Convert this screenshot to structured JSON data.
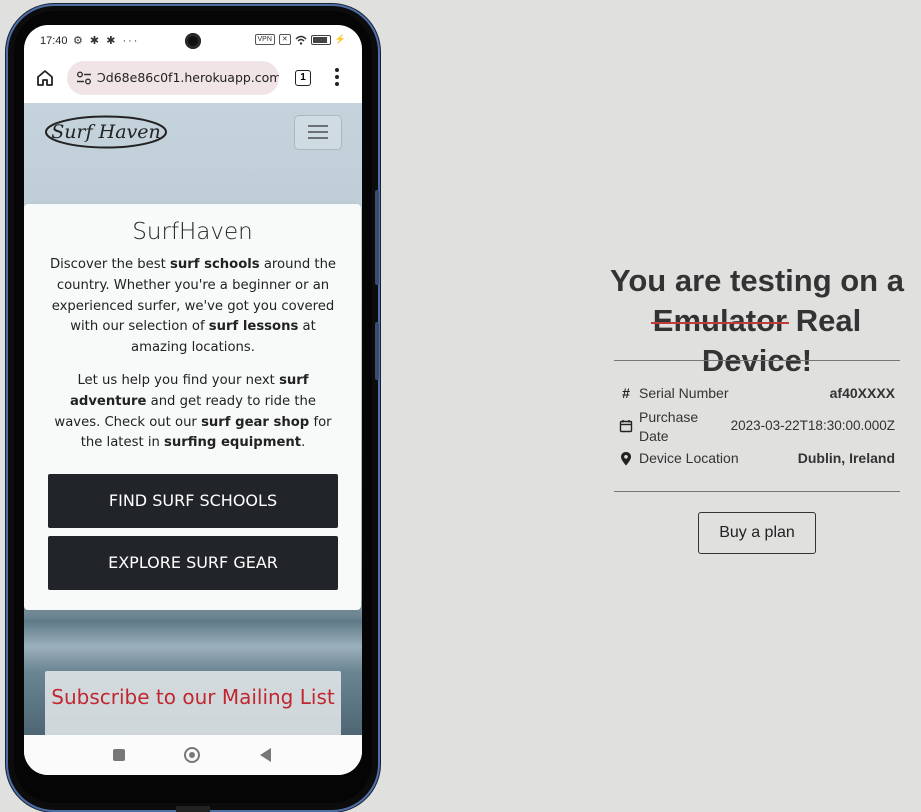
{
  "status_bar": {
    "time": "17:40",
    "left_icons": "⚙ ✱ ✱ ···",
    "vpn": "VPN",
    "signal": "✕"
  },
  "browser": {
    "url": "Ͻd68e86c0f1.herokuapp.com",
    "tab_count": "1"
  },
  "site": {
    "logo_text": "Surf Haven",
    "card_title": "SurfHaven",
    "para1": [
      {
        "t": "Discover the best ",
        "b": false
      },
      {
        "t": "surf schools",
        "b": true
      },
      {
        "t": " around the country. Whether you're a beginner or an experienced surfer, we've got you covered with our selection of ",
        "b": false
      },
      {
        "t": "surf lessons",
        "b": true
      },
      {
        "t": " at amazing locations.",
        "b": false
      }
    ],
    "para2": [
      {
        "t": "Let us help you find your next ",
        "b": false
      },
      {
        "t": "surf adventure",
        "b": true
      },
      {
        "t": " and get ready to ride the waves. Check out our ",
        "b": false
      },
      {
        "t": "surf gear shop",
        "b": true
      },
      {
        "t": " for the latest in ",
        "b": false
      },
      {
        "t": "surfing equipment",
        "b": true
      },
      {
        "t": ".",
        "b": false
      }
    ],
    "btn_find": "FIND SURF SCHOOLS",
    "btn_explore": "EXPLORE SURF GEAR",
    "subscribe": "Subscribe to our Mailing List"
  },
  "panel": {
    "headline_line1": "You are testing on a",
    "headline_strike": "Emulator",
    "headline_line2_rest": " Real Device!",
    "rows": [
      {
        "icon": "hash-icon",
        "label": "Serial Number",
        "value": "af40XXXX"
      },
      {
        "icon": "calendar-icon",
        "label": "Purchase Date",
        "value": "2023-03-22T18:30:00.000Z"
      },
      {
        "icon": "location-pin-icon",
        "label": "Device Location",
        "value": "Dublin, Ireland"
      }
    ],
    "plan_button": "Buy a plan"
  },
  "colors": {
    "background": "#e0e0df",
    "dark_button": "#212529",
    "subscribe_red": "#c0272f",
    "strike_red": "#c0393b",
    "url_pill": "#f1e4e6"
  }
}
